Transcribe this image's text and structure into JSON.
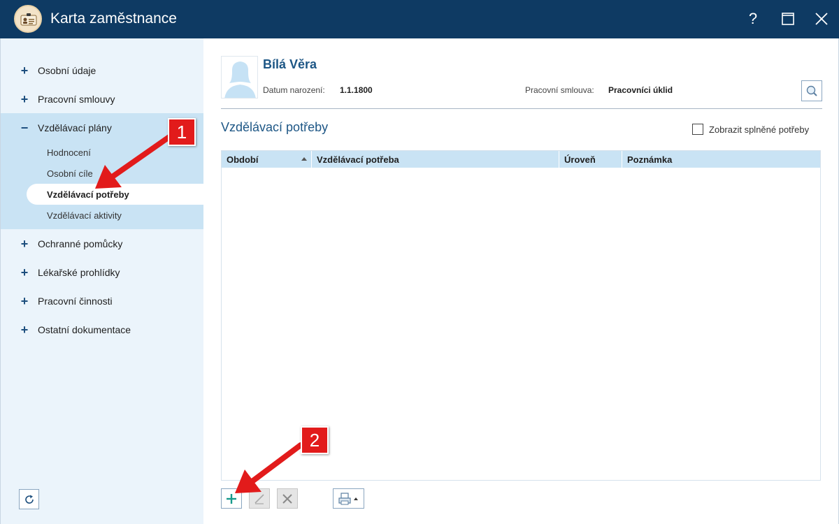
{
  "window": {
    "title": "Karta zaměstnance",
    "help_label": "?",
    "maximize_label": "□",
    "close_label": "✕"
  },
  "sidebar": {
    "items": [
      {
        "symbol": "+",
        "label": "Osobní údaje"
      },
      {
        "symbol": "+",
        "label": "Pracovní smlouvy"
      },
      {
        "symbol": "−",
        "label": "Vzdělávací plány"
      },
      {
        "symbol": "+",
        "label": "Ochranné pomůcky"
      },
      {
        "symbol": "+",
        "label": "Lékařské prohlídky"
      },
      {
        "symbol": "+",
        "label": "Pracovní činnosti"
      },
      {
        "symbol": "+",
        "label": "Ostatní dokumentace"
      }
    ],
    "subitems": [
      {
        "label": "Hodnocení"
      },
      {
        "label": "Osobní cíle"
      },
      {
        "label": "Vzdělávací potřeby",
        "active": true
      },
      {
        "label": "Vzdělávací aktivity"
      }
    ]
  },
  "employee": {
    "name": "Bílá Věra",
    "birth_label": "Datum narození:",
    "birth_value": "1.1.1800",
    "contract_label": "Pracovní smlouva:",
    "contract_value": "Pracovníci úklid"
  },
  "section": {
    "title": "Vzdělávací potřeby",
    "show_completed_label": "Zobrazit splněné potřeby",
    "show_completed_checked": false
  },
  "grid": {
    "columns": [
      "Období",
      "Vzdělávací potřeba",
      "Úroveň",
      "Poznámka"
    ],
    "sorted_column": "Období",
    "rows": []
  },
  "toolbar": {
    "add_icon": "plus-icon",
    "edit_icon": "pencil-icon",
    "delete_icon": "x-icon",
    "print_icon": "printer-icon",
    "refresh_icon": "refresh-icon"
  },
  "annotations": {
    "badge1": "1",
    "badge2": "2",
    "color": "#e21b1b"
  },
  "colors": {
    "titlebar": "#0e3a63",
    "accent": "#1d5685",
    "sidebar_bg": "#ebf4fb",
    "selected_bg": "#c9e3f4"
  }
}
